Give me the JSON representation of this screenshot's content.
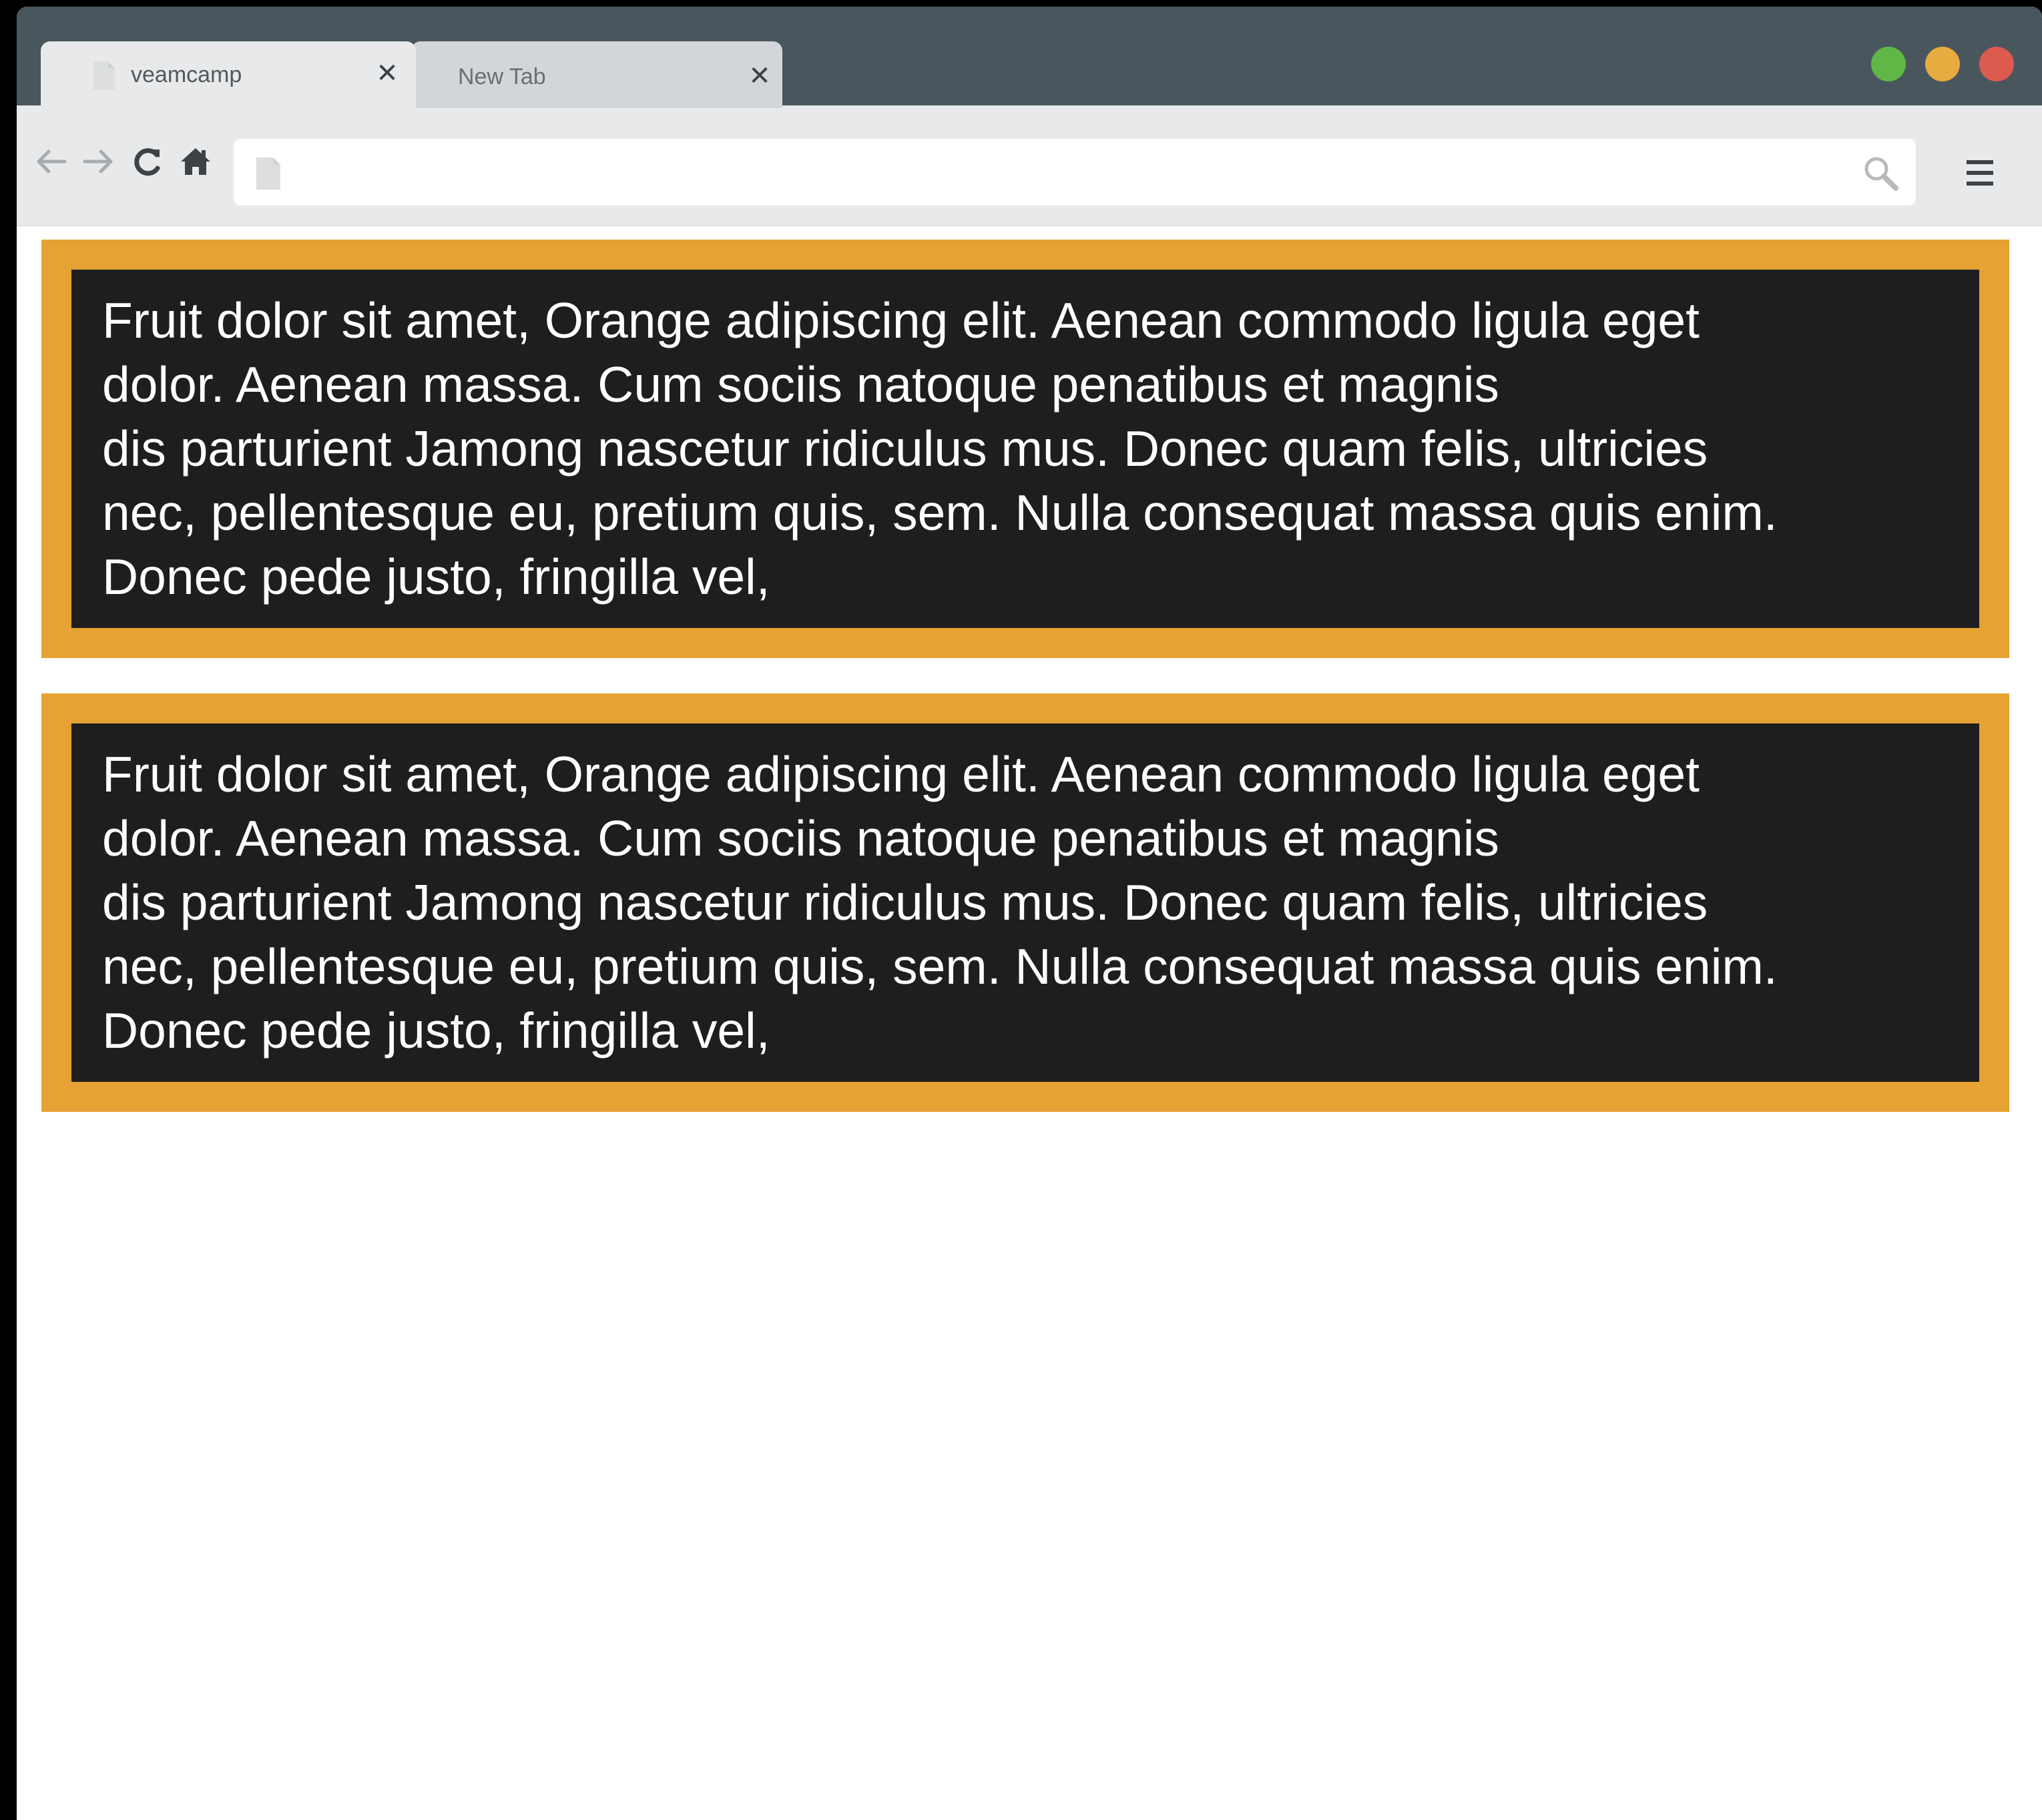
{
  "browser": {
    "tabs": [
      {
        "label": "veamcamp",
        "active": true,
        "close_glyph": "✕"
      },
      {
        "label": "New Tab",
        "active": false,
        "close_glyph": "✕"
      }
    ],
    "window_controls": {
      "colors": {
        "green": "#61b745",
        "yellow": "#e8ab3f",
        "red": "#dd5a51"
      }
    },
    "toolbar": {
      "icons": [
        "back-arrow-icon",
        "forward-arrow-icon",
        "reload-icon",
        "home-icon"
      ],
      "address": {
        "value": "",
        "placeholder": ""
      },
      "search_icon": "magnifier-icon",
      "menu_icon": "hamburger-menu-icon"
    }
  },
  "page": {
    "colors": {
      "card_border": "#e6a233",
      "card_bg": "#1e1e1e",
      "text": "#ffffff"
    },
    "cards": [
      {
        "lines": [
          "Fruit dolor sit amet, Orange adipiscing elit. Aenean commodo ligula eget",
          "dolor. Aenean massa. Cum sociis natoque penatibus et magnis",
          "dis parturient Jamong nascetur ridiculus mus. Donec quam felis, ultricies",
          "nec, pellentesque eu, pretium quis, sem. Nulla consequat massa quis enim.",
          "Donec pede justo, fringilla vel,"
        ]
      },
      {
        "lines": [
          "Fruit dolor sit amet, Orange adipiscing elit. Aenean commodo ligula eget",
          "dolor. Aenean massa. Cum sociis natoque penatibus et magnis",
          "dis parturient Jamong nascetur ridiculus mus. Donec quam felis, ultricies",
          "nec, pellentesque eu, pretium quis, sem. Nulla consequat massa quis enim.",
          "Donec pede justo, fringilla vel,"
        ]
      }
    ]
  }
}
